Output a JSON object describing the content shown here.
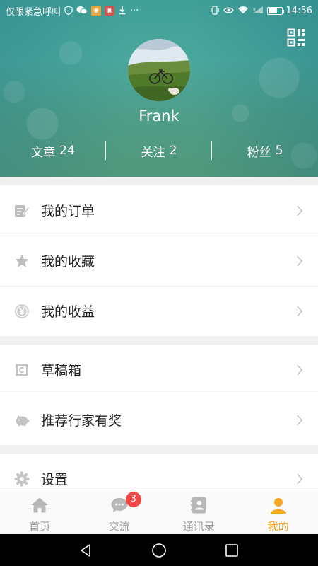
{
  "status_bar": {
    "carrier_text": "仅限紧急呼叫",
    "overflow": "···",
    "time": "14:56"
  },
  "profile": {
    "username": "Frank",
    "qr_icon": "qr-code-icon",
    "stats": [
      {
        "label": "文章",
        "value": "24"
      },
      {
        "label": "关注",
        "value": "2"
      },
      {
        "label": "粉丝",
        "value": "5"
      }
    ]
  },
  "menu": {
    "groups": [
      [
        {
          "label": "我的订单",
          "icon": "edit-icon"
        },
        {
          "label": "我的收藏",
          "icon": "star-icon"
        },
        {
          "label": "我的收益",
          "icon": "yen-coin-icon"
        }
      ],
      [
        {
          "label": "草稿箱",
          "icon": "draft-icon"
        },
        {
          "label": "推荐行家有奖",
          "icon": "piggy-bank-icon"
        }
      ],
      [
        {
          "label": "设置",
          "icon": "gear-icon"
        }
      ]
    ]
  },
  "tabbar": {
    "tabs": [
      {
        "label": "首页",
        "icon": "home-icon",
        "active": false
      },
      {
        "label": "交流",
        "icon": "chat-icon",
        "badge": "3",
        "active": false
      },
      {
        "label": "通讯录",
        "icon": "contacts-icon",
        "active": false
      },
      {
        "label": "我的",
        "icon": "user-icon",
        "active": true
      }
    ]
  },
  "colors": {
    "accent": "#f5a623",
    "badge": "#f04848",
    "header_teal": "#4aa79d",
    "icon_gray": "#b8b8b8"
  }
}
